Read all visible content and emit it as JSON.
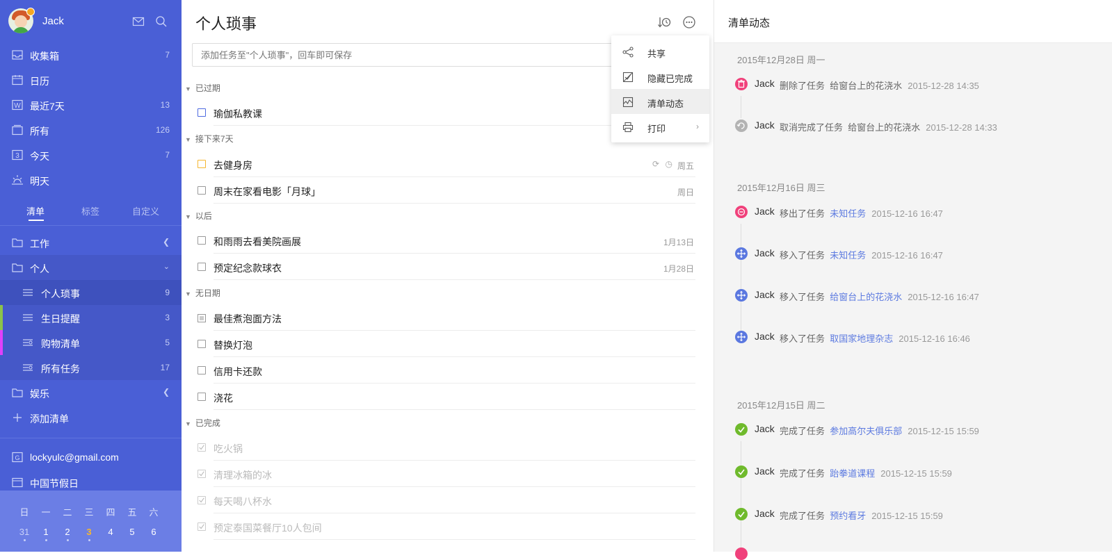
{
  "sidebar": {
    "user": "Jack",
    "smart_lists": [
      {
        "label": "收集箱",
        "count": "7",
        "icon": "inbox-icon"
      },
      {
        "label": "日历",
        "count": "",
        "icon": "calendar-icon"
      },
      {
        "label": "最近7天",
        "count": "13",
        "icon": "week-icon"
      },
      {
        "label": "所有",
        "count": "126",
        "icon": "all-icon"
      },
      {
        "label": "今天",
        "count": "7",
        "icon": "today-icon"
      },
      {
        "label": "明天",
        "count": "",
        "icon": "tomorrow-icon"
      }
    ],
    "tabs": [
      "清单",
      "标签",
      "自定义"
    ],
    "folders": {
      "work": "工作",
      "personal": "个人",
      "lists": [
        {
          "label": "个人琐事",
          "count": "9",
          "color": ""
        },
        {
          "label": "生日提醒",
          "count": "3",
          "color": "#8bc34a"
        },
        {
          "label": "购物清单",
          "count": "5",
          "color": "#e040fb"
        },
        {
          "label": "所有任务",
          "count": "17",
          "color": ""
        }
      ],
      "fun": "娱乐",
      "add_list": "添加清单"
    },
    "accounts": [
      {
        "label": "lockyulc@gmail.com"
      },
      {
        "label": "中国节假日"
      }
    ],
    "calendar": {
      "weekdays": [
        "日",
        "一",
        "二",
        "三",
        "四",
        "五",
        "六"
      ],
      "days": [
        "31",
        "1",
        "2",
        "3",
        "4",
        "5",
        "6"
      ],
      "today_index": 3
    }
  },
  "main": {
    "title": "个人琐事",
    "add_placeholder": "添加任务至\"个人琐事\"，回车即可保存",
    "sections": {
      "overdue": "已过期",
      "next7": "接下来7天",
      "later": "以后",
      "nodate": "无日期",
      "done": "已完成"
    },
    "tasks": {
      "overdue": [
        {
          "name": "瑜伽私教课",
          "due": ""
        }
      ],
      "next7": [
        {
          "name": "去健身房",
          "due": "周五"
        },
        {
          "name": "周末在家看电影「月球」",
          "due": "周日"
        }
      ],
      "later": [
        {
          "name": "和雨雨去看美院画展",
          "due": "1月13日"
        },
        {
          "name": "预定纪念款球衣",
          "due": "1月28日"
        }
      ],
      "nodate": [
        {
          "name": "最佳煮泡面方法"
        },
        {
          "name": "替换灯泡"
        },
        {
          "name": "信用卡还款"
        },
        {
          "name": "浇花"
        }
      ],
      "done": [
        {
          "name": "吃火锅"
        },
        {
          "name": "清理冰箱的冰"
        },
        {
          "name": "每天喝八杯水"
        },
        {
          "name": "预定泰国菜餐厅10人包间"
        }
      ]
    }
  },
  "menu": {
    "items": [
      {
        "label": "共享",
        "icon": "share-icon"
      },
      {
        "label": "隐藏已完成",
        "icon": "hide-completed-icon"
      },
      {
        "label": "清单动态",
        "icon": "activity-icon"
      },
      {
        "label": "打印",
        "icon": "print-icon"
      }
    ]
  },
  "activity": {
    "title": "清单动态",
    "groups": [
      {
        "date": "2015年12月28日 周一",
        "items": [
          {
            "who": "Jack",
            "action": "删除了任务",
            "obj": "给窗台上的花浇水",
            "time": "2015-12-28 14:35",
            "icon": "delete",
            "link": false
          },
          {
            "who": "Jack",
            "action": "取消完成了任务",
            "obj": "给窗台上的花浇水",
            "time": "2015-12-28 14:33",
            "icon": "undo",
            "link": false
          }
        ]
      },
      {
        "date": "2015年12月16日 周三",
        "items": [
          {
            "who": "Jack",
            "action": "移出了任务",
            "obj": "未知任务",
            "time": "2015-12-16 16:47",
            "icon": "remove",
            "link": true
          },
          {
            "who": "Jack",
            "action": "移入了任务",
            "obj": "未知任务",
            "time": "2015-12-16 16:47",
            "icon": "move",
            "link": true
          },
          {
            "who": "Jack",
            "action": "移入了任务",
            "obj": "给窗台上的花浇水",
            "time": "2015-12-16 16:47",
            "icon": "move",
            "link": true
          },
          {
            "who": "Jack",
            "action": "移入了任务",
            "obj": "取国家地理杂志",
            "time": "2015-12-16 16:46",
            "icon": "move",
            "link": true
          }
        ]
      },
      {
        "date": "2015年12月15日 周二",
        "items": [
          {
            "who": "Jack",
            "action": "完成了任务",
            "obj": "参加高尔夫俱乐部",
            "time": "2015-12-15 15:59",
            "icon": "complete",
            "link": true
          },
          {
            "who": "Jack",
            "action": "完成了任务",
            "obj": "跆拳道课程",
            "time": "2015-12-15 15:59",
            "icon": "complete",
            "link": true
          },
          {
            "who": "Jack",
            "action": "完成了任务",
            "obj": "预约看牙",
            "time": "2015-12-15 15:59",
            "icon": "complete",
            "link": true
          }
        ]
      }
    ]
  }
}
